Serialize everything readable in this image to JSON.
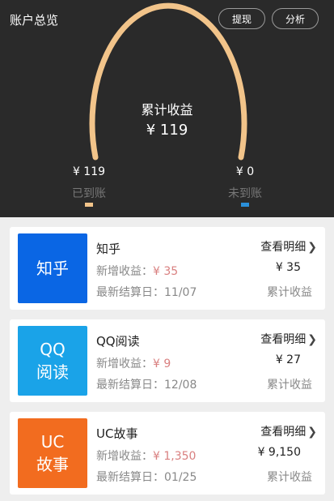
{
  "header": {
    "title": "账户总览",
    "withdraw_label": "提现",
    "analysis_label": "分析",
    "center_label": "累计收益",
    "center_value": "¥ 119",
    "settled_amount": "¥ 119",
    "settled_label": "已到账",
    "unsettled_amount": "¥ 0",
    "unsettled_label": "未到账",
    "colors": {
      "settled": "#f2c48a",
      "unsettled": "#2a8fd9"
    }
  },
  "cards": [
    {
      "logo_lines": [
        "知乎"
      ],
      "logo_color": "#0a66e4",
      "name": "知乎",
      "new_earn_label": "新增收益：",
      "new_earn_amount": "¥ 35",
      "settle_label": "最新结算日：",
      "settle_date": "11/07",
      "detail_label": "查看明细",
      "chevron_icon": "chevron-right-icon",
      "total_value": "¥ 35",
      "total_label": "累计收益"
    },
    {
      "logo_lines": [
        "QQ",
        "阅读"
      ],
      "logo_color": "#1aa3e8",
      "name": "QQ阅读",
      "new_earn_label": "新增收益：",
      "new_earn_amount": "¥ 9",
      "settle_label": "最新结算日：",
      "settle_date": "12/08",
      "detail_label": "查看明细",
      "chevron_icon": "chevron-right-icon",
      "total_value": "¥ 27",
      "total_label": "累计收益"
    },
    {
      "logo_lines": [
        "UC",
        "故事"
      ],
      "logo_color": "#f26c1f",
      "name": "UC故事",
      "new_earn_label": "新增收益：",
      "new_earn_amount": "¥ 1,350",
      "settle_label": "最新结算日：",
      "settle_date": "01/25",
      "detail_label": "查看明细",
      "chevron_icon": "chevron-right-icon",
      "total_value": "¥ 9,150",
      "total_label": "累计收益"
    }
  ]
}
